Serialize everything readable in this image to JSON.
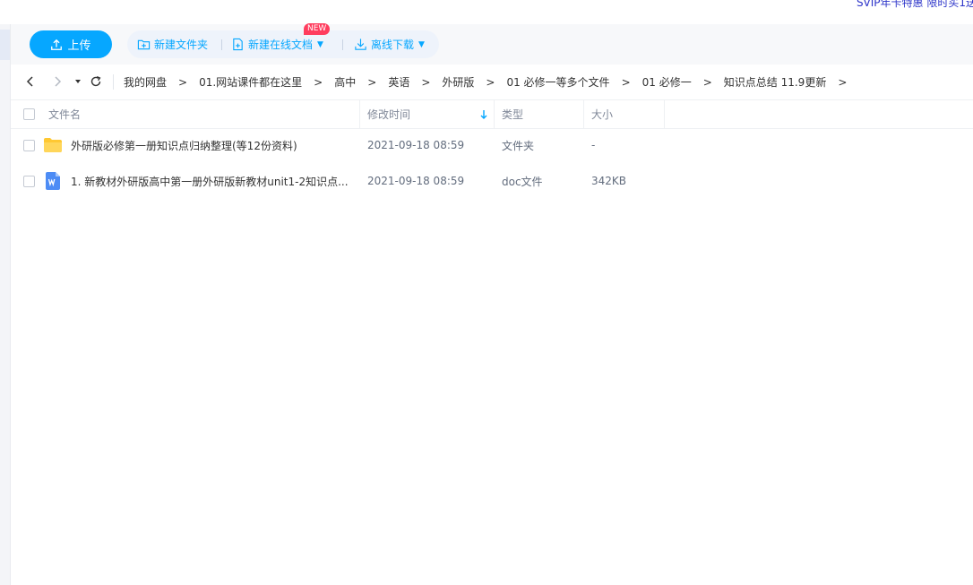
{
  "promo": {
    "text": "SVIP年卡特惠 限时买1送"
  },
  "toolbar": {
    "upload_label": "上传",
    "new_folder_label": "新建文件夹",
    "new_doc_label": "新建在线文档",
    "new_badge": "NEW",
    "offline_download_label": "离线下载",
    "caret": "▼",
    "accent_color": "#06a7ff"
  },
  "breadcrumb": {
    "separator": ">",
    "items": [
      "我的网盘",
      "01.网站课件都在这里",
      "高中",
      "英语",
      "外研版",
      "01 必修一等多个文件",
      "01 必修一",
      "知识点总结 11.9更新"
    ]
  },
  "table": {
    "headers": {
      "name": "文件名",
      "modified": "修改时间",
      "type": "类型",
      "size": "大小"
    },
    "sort": {
      "column": "modified",
      "direction": "descending"
    },
    "rows": [
      {
        "icon": "folder-icon",
        "name": "外研版必修第一册知识点归纳整理(等12份资料)",
        "modified": "2021-09-18 08:59",
        "type": "文件夹",
        "size": "-"
      },
      {
        "icon": "word-doc-icon",
        "name": "1. 新教材外研版高中第一册外研版新教材unit1-2知识点...",
        "modified": "2021-09-18 08:59",
        "type": "doc文件",
        "size": "342KB"
      }
    ]
  }
}
